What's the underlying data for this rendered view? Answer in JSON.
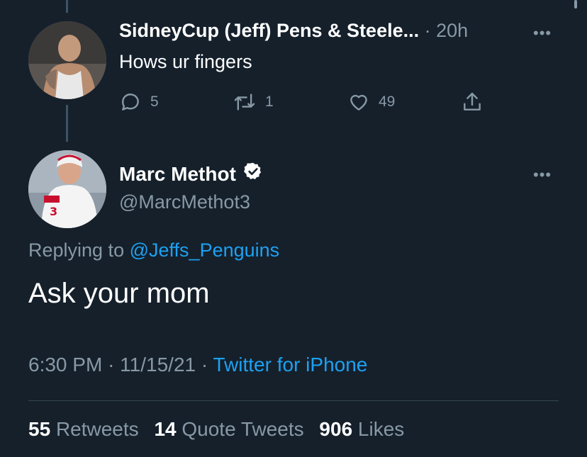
{
  "parent_tweet": {
    "display_name": "SidneyCup (Jeff) Pens & Steele...",
    "separator": "·",
    "time_ago": "20h",
    "more": "•••",
    "text": "Hows ur fingers",
    "actions": {
      "reply_count": "5",
      "retweet_count": "1",
      "like_count": "49"
    },
    "icons": [
      "reply-icon",
      "retweet-icon",
      "like-icon",
      "share-icon"
    ]
  },
  "reply_tweet": {
    "display_name": "Marc Methot",
    "handle": "@MarcMethot3",
    "verified": true,
    "more": "•••",
    "replying_prefix": "Replying to",
    "replying_to": "@Jeffs_Penguins",
    "text": "Ask your mom",
    "time": "6:30 PM",
    "date": "11/15/21",
    "sep": "·",
    "source": "Twitter for iPhone",
    "stats": {
      "retweets_count": "55",
      "retweets_label": "Retweets",
      "quotes_count": "14",
      "quotes_label": "Quote Tweets",
      "likes_count": "906",
      "likes_label": "Likes"
    }
  },
  "colors": {
    "background": "#15202b",
    "dim_text": "#8899a6",
    "link": "#1da1f2",
    "divider": "#38444d"
  }
}
